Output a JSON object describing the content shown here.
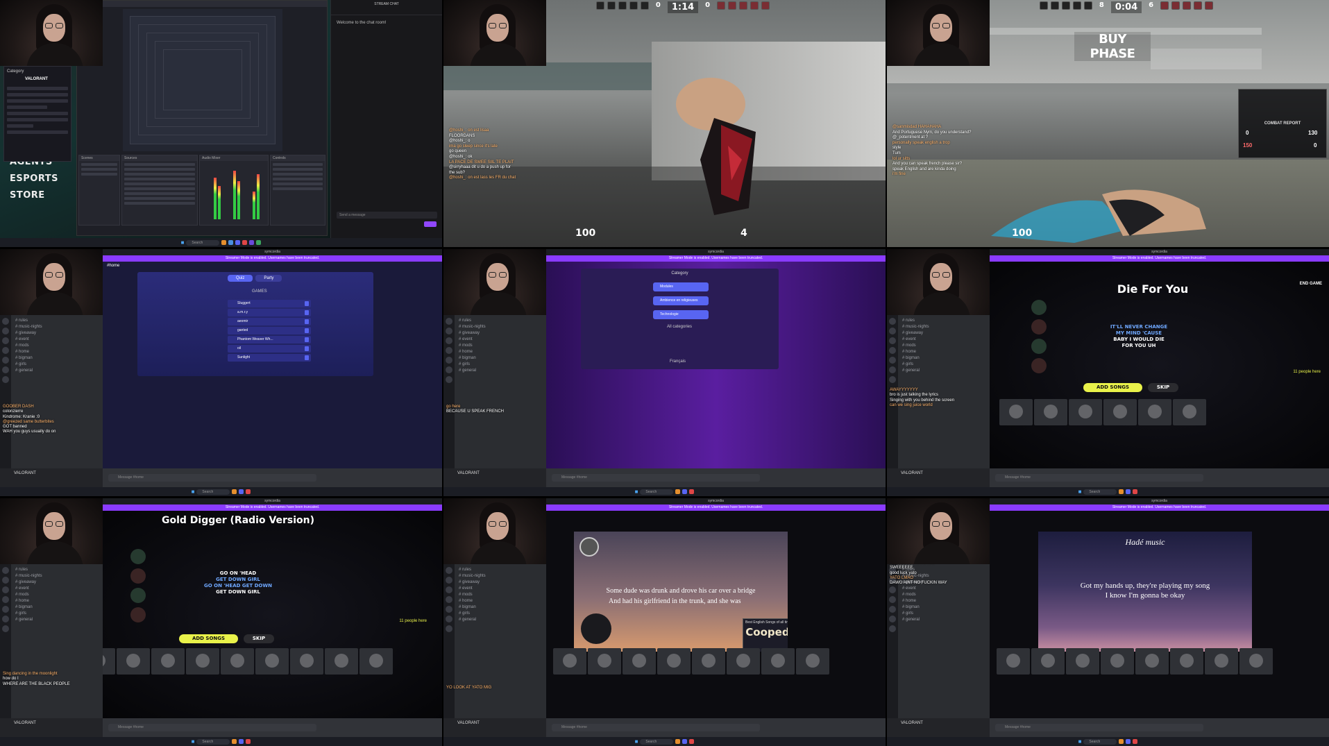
{
  "obs": {
    "menu": [
      "AGENTS",
      "ESPORTS",
      "STORE"
    ],
    "chat_header": "STREAM CHAT",
    "chat_welcome": "Welcome to the chat room!",
    "chat_placeholder": "Send a message",
    "category_label": "Category",
    "category_value": "VALORANT"
  },
  "valorant_live": {
    "timer": "1:14",
    "score_left": "0",
    "score_right": "0",
    "health": "100",
    "ammo": "4",
    "chat": [
      {
        "user": "",
        "text": "@hoshi_: on est lisaa"
      },
      {
        "user": "",
        "text": "FLOORDANS"
      },
      {
        "user": "",
        "text": "@hoshi_: o"
      },
      {
        "user": "",
        "text": "ima go sleep since it's late"
      },
      {
        "user": "",
        "text": "go queen"
      },
      {
        "user": "",
        "text": "@hoshi_: ok"
      },
      {
        "user": "",
        "text": "LA PACE DE SWEE SIIL TE PLAIT"
      },
      {
        "user": "",
        "text": "@sirryhaaa dit u do a push up for"
      },
      {
        "user": "",
        "text": "the sub?"
      },
      {
        "user": "",
        "text": "@hoshi_: on est lass les FR du chat"
      }
    ]
  },
  "valorant_buy": {
    "timer": "0:04",
    "score_left": "8",
    "score_right": "6",
    "buy_phase": "BUY PHASE",
    "combat_report": "COMBAT REPORT",
    "combat_left": "0",
    "combat_right": "130",
    "combat_left2": "150",
    "combat_right2": "0",
    "health": "100",
    "chat": [
      {
        "user": "",
        "text": "@sanmisdad HAHAHAHA"
      },
      {
        "user": "",
        "text": "And Portuguese Nym, do you understand?"
      },
      {
        "user": "",
        "text": "@_potentment at ?"
      },
      {
        "user": "",
        "text": "personally speak english a trop"
      },
      {
        "user": "",
        "text": "style"
      },
      {
        "user": "",
        "text": "Tum"
      },
      {
        "user": "",
        "text": "lol ur sitts"
      },
      {
        "user": "",
        "text": "And you can speak french please sir?"
      },
      {
        "user": "",
        "text": "speak English and are kinda doing"
      },
      {
        "user": "",
        "text": "i'm fine"
      }
    ]
  },
  "discord": {
    "app_title": "symcordia",
    "streamer_banner": "Streamer Mode is enabled. Usernames have been truncated.",
    "channel": "#home",
    "search_placeholder": "Search",
    "message_placeholder": "Message #home",
    "user_name": "VALORANT",
    "channels": [
      "# rules",
      "# music-nights",
      "# giveaway",
      "# event",
      "# mods",
      "# home",
      "# bigman",
      "# girls",
      "# general"
    ]
  },
  "games_panel": {
    "tab_quiz": "Quiz",
    "tab_party": "Party",
    "section": "GAMES",
    "items": [
      "Sluggert",
      "a.m.r.y",
      "aeomir",
      "ganted",
      "Phantom Weaver Wh...",
      "oil",
      "Sunlight"
    ]
  },
  "category_panel": {
    "title": "Category",
    "items": [
      "Modules",
      "Ambience en religieuses",
      "Technologie"
    ],
    "all_label": "All categories",
    "lang": "Français"
  },
  "song1": {
    "title": "Die For You",
    "end_button": "END GAME",
    "lyrics": [
      "IT'LL NEVER CHANGE",
      "MY MIND 'CAUSE",
      "BABY I WOULD DIE",
      "FOR YOU UH"
    ],
    "add_songs": "ADD SONGS",
    "skip": "SKIP",
    "people": "11 people here"
  },
  "song2": {
    "title": "Gold Digger (Radio Version)",
    "lyrics": [
      "GO ON 'HEAD",
      "GET DOWN GIRL",
      "GO ON 'HEAD GET DOWN",
      "GET DOWN GIRL"
    ],
    "add_songs": "ADD SONGS",
    "skip": "SKIP",
    "people": "11 people here"
  },
  "video1": {
    "line1": "Some dude was drunk and drove his car over a bridge",
    "line2": "And had his girlfriend in the trunk, and she was",
    "card_title": "Best English Songs of all time 2000-2021",
    "card_big": "Cooped Up"
  },
  "video2": {
    "header": "Hadé music",
    "line1": "Got my hands up, they're playing my song",
    "line2": "I know I'm gonna be okay"
  },
  "chat_overlay_discord": [
    {
      "user": "Ryeuwhai",
      "text": "GOOBER DASH"
    },
    {
      "user": "",
      "text": "colonzierre"
    },
    {
      "user": "",
      "text": "Kindrome: Kranie :0"
    },
    {
      "user": "",
      "text": "@greezed same butterbites"
    },
    {
      "user": "",
      "text": "GOT banned"
    },
    {
      "user": "",
      "text": "WAH you guys usually do on"
    },
    {
      "user": "",
      "text": "go here"
    },
    {
      "user": "",
      "text": "BECAUSE U SPEAK FRENCH"
    },
    {
      "user": "",
      "text": "AWAYYYYYYY"
    },
    {
      "user": "",
      "text": "bro is just talking the lyrics"
    },
    {
      "user": "",
      "text": "Singing with you behind the screen"
    },
    {
      "user": "",
      "text": "can we sing juice world"
    },
    {
      "user": "",
      "text": "Sing dancing in the moonlight"
    },
    {
      "user": "",
      "text": "how do I"
    },
    {
      "user": "",
      "text": "WHERE ARE THE BLACK PEOPLE"
    },
    {
      "user": "",
      "text": "YO LOOK AT YATO MIG"
    },
    {
      "user": "",
      "text": "SWEEEEEE"
    },
    {
      "user": "",
      "text": "good luck yato"
    },
    {
      "user": "",
      "text": "YATO LMAO"
    },
    {
      "user": "",
      "text": "DAWG AINT NO FUCKIN WAY"
    }
  ],
  "taskbar": {
    "search": "Search"
  }
}
